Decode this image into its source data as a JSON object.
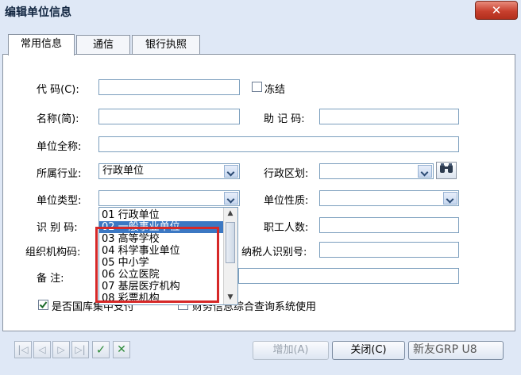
{
  "window": {
    "title": "编辑单位信息",
    "close_glyph": "✕"
  },
  "tabs": [
    {
      "label": "常用信息"
    },
    {
      "label": "通信"
    },
    {
      "label": "银行执照"
    }
  ],
  "form": {
    "code_label": "代  码(C):",
    "freeze_label": "冻结",
    "short_name_label": "名称(简):",
    "mnemonic_label": "助 记 码:",
    "full_name_label": "单位全称:",
    "industry_label": "所属行业:",
    "industry_value": "行政单位",
    "region_label": "行政区划:",
    "unit_type_label": "单位类型:",
    "unit_nature_label": "单位性质:",
    "id_code_label": "识 别 码:",
    "staff_count_label": "职工人数:",
    "org_code_label": "组织机构码:",
    "taxpayer_label": "纳税人识别号:",
    "remark_label": "备      注:",
    "state_treasury_label": "是否国库集中支付",
    "finance_query_label": "财务信息综合查询系统使用"
  },
  "unit_type_options": [
    {
      "label": "01 行政单位"
    },
    {
      "label": "02 一般事业单位"
    },
    {
      "label": "03 高等学校"
    },
    {
      "label": "04 科学事业单位"
    },
    {
      "label": "05 中小学"
    },
    {
      "label": "06 公立医院"
    },
    {
      "label": "07 基层医疗机构"
    },
    {
      "label": "08 彩票机构"
    }
  ],
  "buttons": {
    "add": "增加(A)",
    "close": "关闭(C)"
  },
  "watermark": "新友GRP U8",
  "accent_colors": {
    "selection": "#3c78c3",
    "highlight_box": "#d62828",
    "panel_border": "#8a94a3"
  }
}
